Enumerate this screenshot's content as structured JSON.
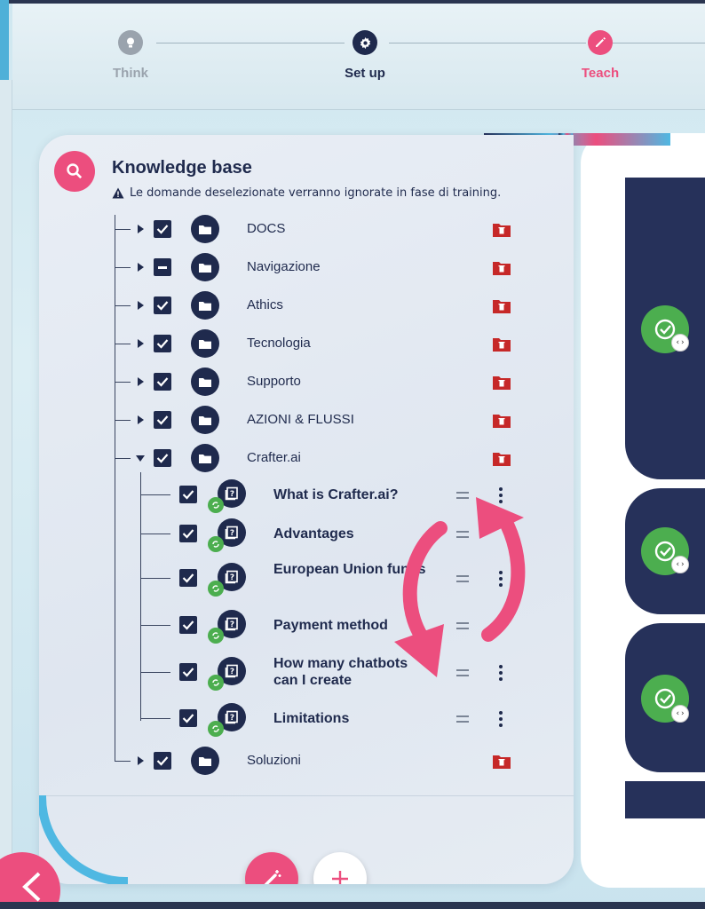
{
  "stepper": {
    "steps": [
      {
        "label": "Think",
        "icon": "lightbulb-icon",
        "color": "#9aa3ad",
        "state": "done"
      },
      {
        "label": "Set up",
        "icon": "gear-icon",
        "color": "#1f2a4d",
        "state": "current"
      },
      {
        "label": "Teach",
        "icon": "pencil-icon",
        "color": "#ec4e7e",
        "state": "upcoming"
      }
    ]
  },
  "knowledge_base": {
    "title": "Knowledge base",
    "warning": "Le domande deselezionate verranno ignorate in fase di training.",
    "folders": [
      {
        "name": "DOCS",
        "checked": "checked",
        "expanded": false
      },
      {
        "name": "Navigazione",
        "checked": "indeterminate",
        "expanded": false
      },
      {
        "name": "Athics",
        "checked": "checked",
        "expanded": false
      },
      {
        "name": "Tecnologia",
        "checked": "checked",
        "expanded": false
      },
      {
        "name": "Supporto",
        "checked": "checked",
        "expanded": false
      },
      {
        "name": "AZIONI & FLUSSI",
        "checked": "checked",
        "expanded": false
      },
      {
        "name": "Crafter.ai",
        "checked": "checked",
        "expanded": true
      },
      {
        "name": "Soluzioni",
        "checked": "checked",
        "expanded": false
      }
    ],
    "questions": [
      {
        "text": "What is Crafter.ai?",
        "checked": true
      },
      {
        "text": "Advantages",
        "checked": true
      },
      {
        "text": "European Union funds",
        "checked": true
      },
      {
        "text": "Payment method",
        "checked": true
      },
      {
        "text": "How many chatbots can I create",
        "checked": true
      },
      {
        "text": "Limitations",
        "checked": true
      }
    ]
  },
  "colors": {
    "accent": "#ec4e7e",
    "navy": "#1f2a4d",
    "success": "#4cae4f",
    "danger": "#c62828",
    "blue": "#4fb8e2"
  }
}
